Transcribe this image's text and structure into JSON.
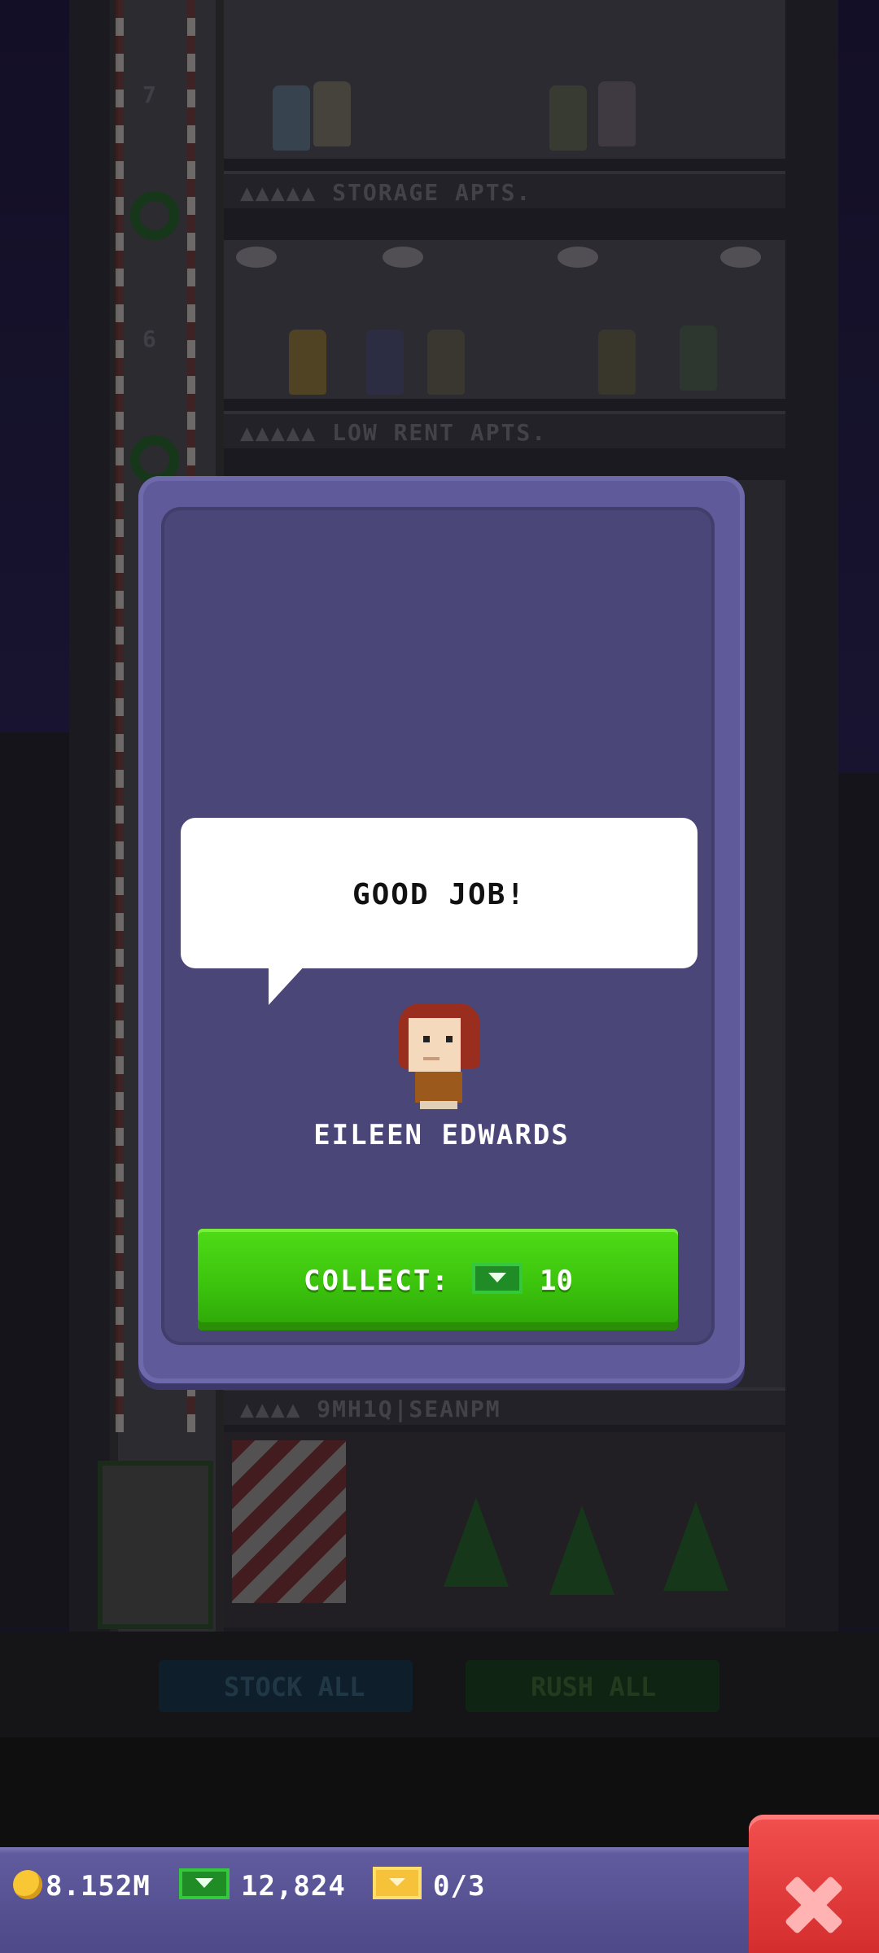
{
  "scene": {
    "floors": [
      {
        "number": "7",
        "sign": "▲▲▲▲▲ STORAGE APTS."
      },
      {
        "number": "6",
        "sign": "▲▲▲▲▲ LOW RENT APTS."
      }
    ],
    "lobby_sign": "▲▲▲▲ 9MH1Q|SEANPM",
    "buttons": {
      "stock_all": "STOCK ALL",
      "rush_all": "RUSH ALL"
    }
  },
  "modal": {
    "speech": "GOOD JOB!",
    "character_name": "EILEEN EDWARDS",
    "collect_label": "COLLECT:",
    "collect_amount": "10",
    "collect_icon": "bux-icon"
  },
  "status_bar": {
    "coins": "8.152M",
    "bux": "12,824",
    "tickets": "0/3",
    "icons": [
      "coin-icon",
      "bux-icon",
      "golden-ticket-icon"
    ]
  },
  "close_icon": "close-icon",
  "colors": {
    "modal_frame": "#5f5a9a",
    "modal_inner": "#4a4677",
    "collect_green": "#3cc40d",
    "close_red": "#e03a3a",
    "status_bar": "#5f5b9e"
  }
}
